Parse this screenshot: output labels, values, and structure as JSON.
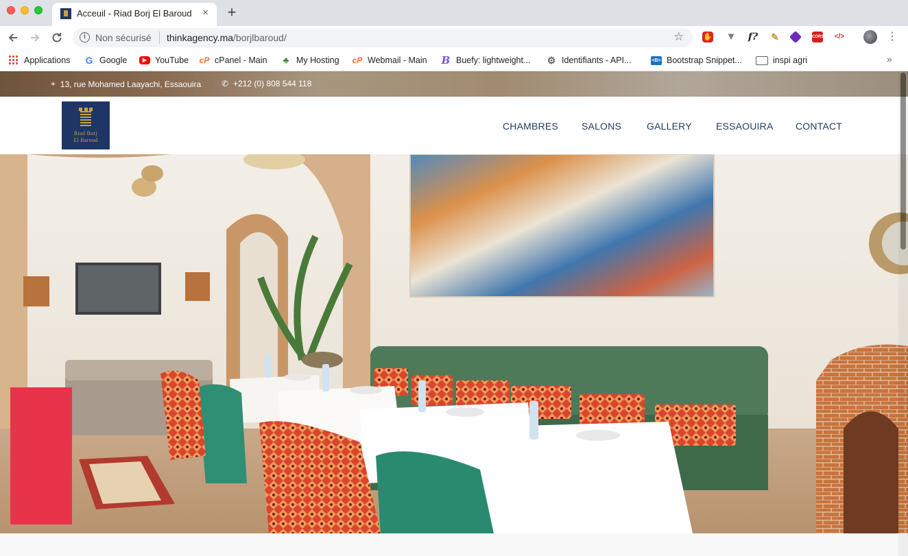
{
  "browser": {
    "tab_title": "Acceuil - Riad Borj El Baroud",
    "tab_close": "×",
    "new_tab": "+",
    "security_label": "Non sécurisé",
    "url_host": "thinkagency.ma",
    "url_path": "/borjlbaroud/",
    "bookmarks": [
      {
        "label": "Applications",
        "icon": "apps-icon"
      },
      {
        "label": "Google",
        "icon": "google-icon"
      },
      {
        "label": "YouTube",
        "icon": "youtube-icon"
      },
      {
        "label": "cPanel - Main",
        "icon": "cpanel-icon"
      },
      {
        "label": "My Hosting",
        "icon": "hosting-icon"
      },
      {
        "label": "Webmail - Main",
        "icon": "cpanel-icon"
      },
      {
        "label": "Buefy: lightweight...",
        "icon": "buefy-icon"
      },
      {
        "label": "Identifiants - API...",
        "icon": "gear-icon"
      },
      {
        "label": "Bootstrap Snippet...",
        "icon": "bootstrap-icon"
      },
      {
        "label": "inspi agri",
        "icon": "folder-icon"
      }
    ],
    "bookmarks_more": "»",
    "extensions": {
      "fquestion": "f?",
      "cors": "CORS",
      "code": "</>"
    }
  },
  "site": {
    "address": "13, rue Mohamed Laayachi, Essaouira",
    "phone": "+212 (0) 808 544 118",
    "logo_line1": "Riad Borj",
    "logo_line2": "El Baroud",
    "nav": [
      "CHAMBRES",
      "SALONS",
      "GALLERY",
      "ESSAOUIRA",
      "CONTACT"
    ]
  },
  "colors": {
    "brand_navy": "#1e3566",
    "brand_gold": "#c9a23a",
    "nav_text": "#1e3a5f"
  }
}
